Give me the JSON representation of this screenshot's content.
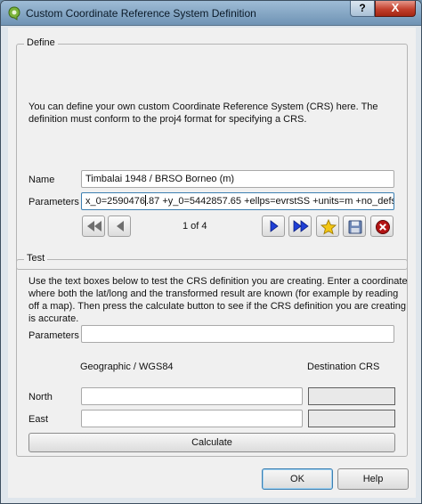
{
  "window": {
    "title": "Custom Coordinate Reference System Definition",
    "help_glyph": "?",
    "close_glyph": "X"
  },
  "define": {
    "legend": "Define",
    "description_line1": "You can define your own custom Coordinate Reference System (CRS) here. The",
    "description_line2": "definition must conform to the proj4 format for specifying a CRS.",
    "name_label": "Name",
    "name_value": "Timbalai 1948 / BRSO Borneo (m)",
    "parameters_label": "Parameters",
    "parameters_value_before_caret": "x_0=2590476",
    "parameters_value_after_caret": ".87 +y_0=5442857.65 +ellps=evrstSS +units=m +no_defs",
    "record_counter": "1 of 4"
  },
  "test": {
    "legend": "Test",
    "description_line1": "Use the text boxes below to test the CRS definition you are creating. Enter a coordinate",
    "description_line2": "where both the lat/long and the transformed result are known (for example by reading",
    "description_line3": "off a map). Then press the calculate button to see if the CRS definition you are creating",
    "description_line4": "is accurate.",
    "parameters_label": "Parameters",
    "parameters_value": "",
    "geographic_header": "Geographic / WGS84",
    "destination_header": "Destination CRS",
    "north_label": "North",
    "east_label": "East",
    "north_value": "",
    "east_value": "",
    "calculate_label": "Calculate"
  },
  "footer": {
    "ok_label": "OK",
    "help_label": "Help"
  },
  "colors": {
    "nav_blue": "#1f3fd6",
    "star_yellow": "#f3c613",
    "delete_red": "#b31414"
  }
}
